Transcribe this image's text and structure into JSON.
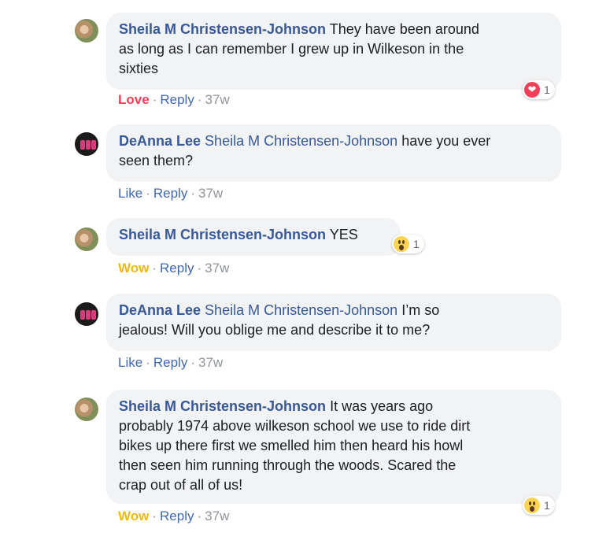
{
  "comments": [
    {
      "author": "Sheila M Christensen-Johnson",
      "mention": "",
      "text_lines": [
        "They have been around",
        "as long as I can remember I grew up in Wilkeson in the",
        "sixties"
      ],
      "reaction_label": "Love",
      "reply_label": "Reply",
      "time": "37w",
      "reaction_icon": "heart-icon",
      "reaction_count": "1"
    },
    {
      "author": "DeAnna Lee",
      "mention": "Sheila M Christensen-Johnson",
      "text_lines": [
        "have you ever",
        "seen them?"
      ],
      "reaction_label": "Like",
      "reply_label": "Reply",
      "time": "37w"
    },
    {
      "author": "Sheila M Christensen-Johnson",
      "mention": "",
      "text_lines": [
        "YES"
      ],
      "reaction_label": "Wow",
      "reply_label": "Reply",
      "time": "37w",
      "reaction_icon": "wow-icon",
      "reaction_count": "1"
    },
    {
      "author": "DeAnna Lee",
      "mention": "Sheila M Christensen-Johnson",
      "text_lines": [
        "I’m so",
        "jealous! Will you oblige me and describe it to me?"
      ],
      "reaction_label": "Like",
      "reply_label": "Reply",
      "time": "37w"
    },
    {
      "author": "Sheila M Christensen-Johnson",
      "mention": "",
      "text_lines": [
        "It was years ago",
        "probably 1974 above wilkeson school we use to ride dirt",
        "bikes up there first we smelled him then heard his howl",
        "then seen him running through the woods. Scared the",
        "crap out of all of us!"
      ],
      "reaction_label": "Wow",
      "reply_label": "Reply",
      "time": "37w",
      "reaction_icon": "wow-icon",
      "reaction_count": "1"
    }
  ],
  "colors": {
    "name": "#385898",
    "love": "#f33e58",
    "wow": "#f0ba15",
    "like": "#4267b2",
    "bubble": "#f2f3f5"
  }
}
